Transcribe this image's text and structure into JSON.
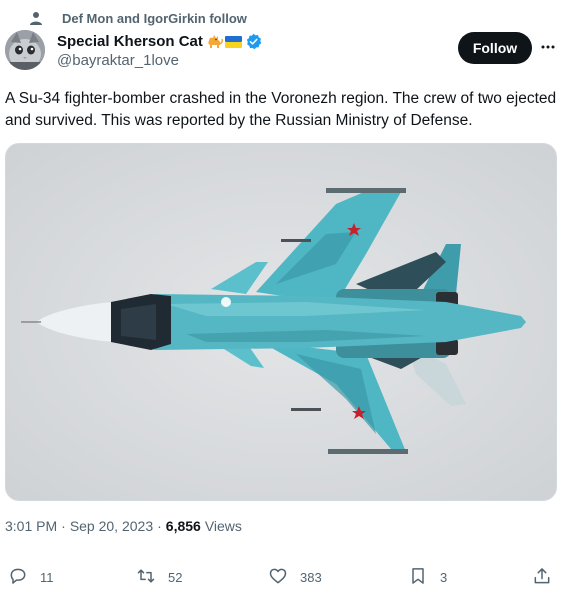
{
  "social_context": {
    "text": "Def Mon and IgorGirkin follow"
  },
  "author": {
    "display_name": "Special Kherson Cat",
    "handle": "@bayraktar_1love"
  },
  "follow_button": {
    "label": "Follow"
  },
  "tweet": {
    "text": "A Su-34 fighter-bomber crashed in the Voronezh region. The crew of two ejected and survived. This was reported by the Russian Ministry of Defense."
  },
  "meta": {
    "time": "3:01 PM",
    "separator": "·",
    "date": "Sep 20, 2023",
    "views_count": "6,856",
    "views_label": "Views"
  },
  "actions": {
    "replies": "11",
    "retweets": "52",
    "likes": "383",
    "bookmarks": "3"
  },
  "colors": {
    "text_primary": "#0f1419",
    "text_secondary": "#536471",
    "verified_blue": "#1d9bf0",
    "follow_bg": "#0f1419"
  },
  "icons": [
    "person-icon",
    "cat-emoji-icon",
    "ukraine-flag-icon",
    "verified-badge-icon",
    "more-icon",
    "reply-icon",
    "retweet-icon",
    "like-icon",
    "bookmark-icon",
    "share-icon"
  ]
}
